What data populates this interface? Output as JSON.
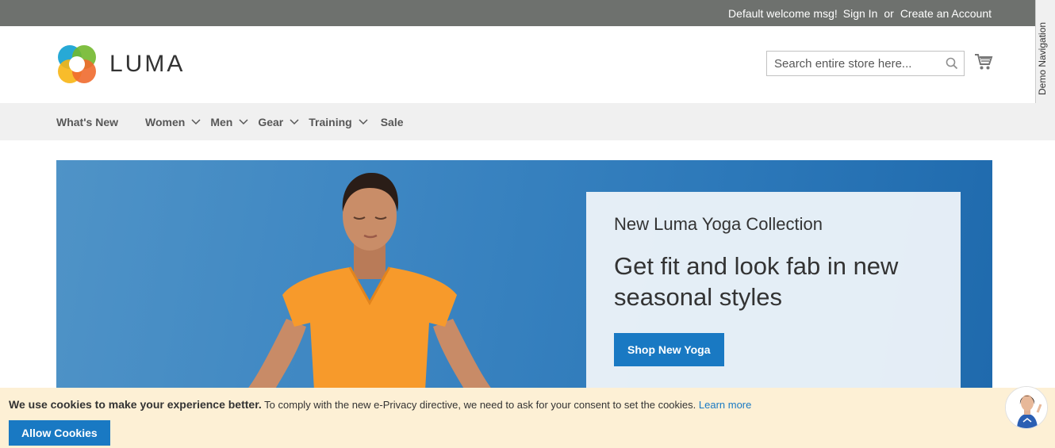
{
  "top_bar": {
    "welcome": "Default welcome msg!",
    "sign_in": "Sign In",
    "or": "or",
    "create_account": "Create an Account"
  },
  "demo_nav": {
    "label": "Demo Navigation"
  },
  "header": {
    "logo_text": "LUMA",
    "search_placeholder": "Search entire store here...",
    "icons": {
      "search": "search-icon",
      "cart": "cart-icon"
    }
  },
  "nav": {
    "items": [
      {
        "label": "What's New",
        "has_dropdown": false
      },
      {
        "label": "Women",
        "has_dropdown": true
      },
      {
        "label": "Men",
        "has_dropdown": true
      },
      {
        "label": "Gear",
        "has_dropdown": true
      },
      {
        "label": "Training",
        "has_dropdown": true
      },
      {
        "label": "Sale",
        "has_dropdown": false
      }
    ]
  },
  "hero": {
    "subtitle": "New Luma Yoga Collection",
    "title": "Get fit and look fab in new seasonal styles",
    "button": "Shop New Yoga"
  },
  "cookie": {
    "bold": "We use cookies to make your experience better.",
    "text": "To comply with the new e-Privacy directive, we need to ask for your consent to set the cookies.",
    "link": "Learn more",
    "button": "Allow Cookies"
  },
  "colors": {
    "top_bar": "#6e716e",
    "nav_bg": "#f0f0f0",
    "accent": "#1979c3",
    "cookie_bg": "#fdf0d5"
  }
}
